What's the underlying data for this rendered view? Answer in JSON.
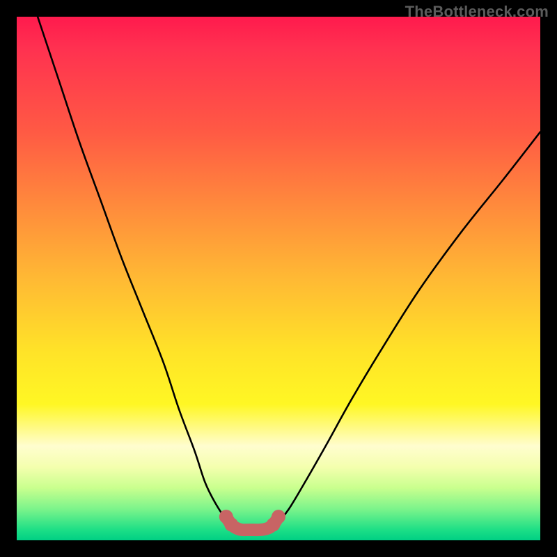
{
  "watermark": "TheBottleneck.com",
  "chart_data": {
    "type": "line",
    "title": "",
    "xlabel": "",
    "ylabel": "",
    "xlim": [
      0,
      100
    ],
    "ylim": [
      0,
      100
    ],
    "grid": false,
    "series": [
      {
        "name": "left-curve",
        "color": "#000000",
        "x": [
          4,
          8,
          12,
          16,
          20,
          24,
          28,
          31,
          34,
          36,
          38,
          40,
          41.5
        ],
        "y": [
          100,
          88,
          76,
          65,
          54,
          44,
          34,
          25,
          17,
          11,
          7,
          4,
          2.5
        ]
      },
      {
        "name": "right-curve",
        "color": "#000000",
        "x": [
          49,
          50,
          52,
          55,
          59,
          64,
          70,
          77,
          85,
          93,
          100
        ],
        "y": [
          2.5,
          3.5,
          6,
          11,
          18,
          27,
          37,
          48,
          59,
          69,
          78
        ]
      },
      {
        "name": "floor-band",
        "color": "#c86464",
        "x": [
          40,
          41,
          42,
          43,
          44.5,
          46.5,
          48,
          49,
          50
        ],
        "y": [
          4.5,
          3,
          2.3,
          2,
          2,
          2,
          2.3,
          3,
          4.5
        ]
      }
    ],
    "annotations": [
      {
        "text": "TheBottleneck.com",
        "position": "top-right"
      }
    ]
  }
}
